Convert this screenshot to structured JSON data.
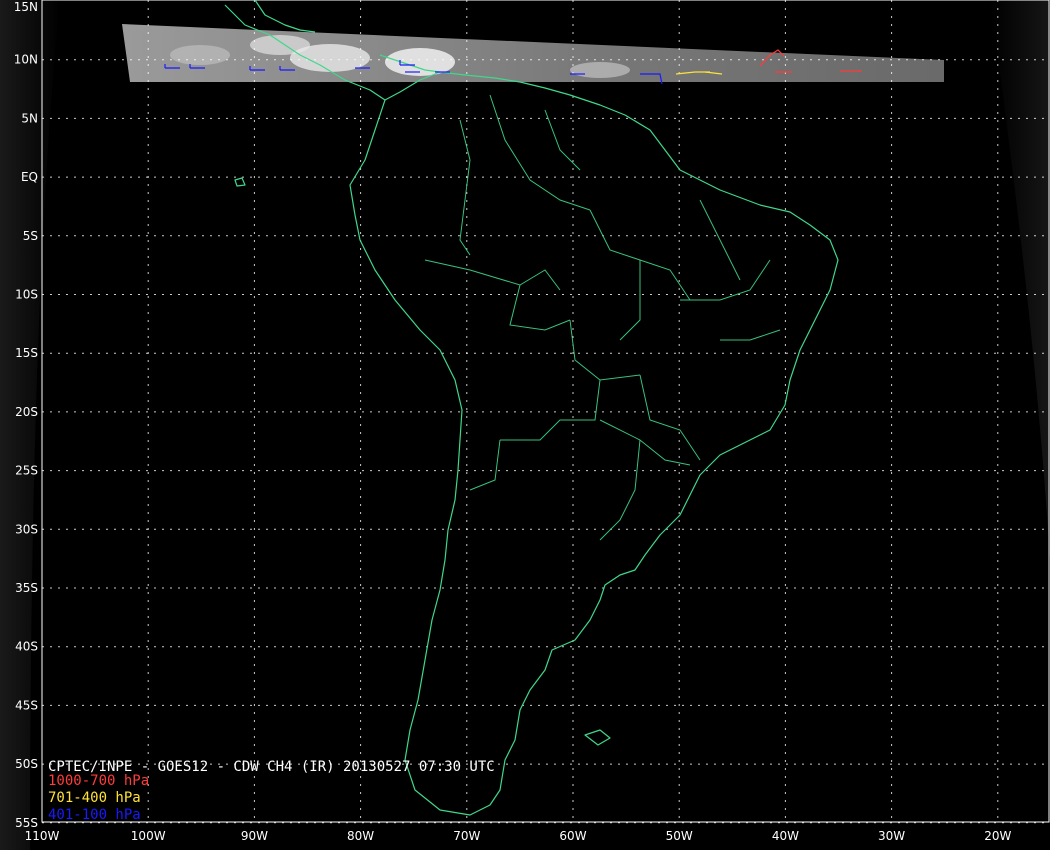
{
  "map": {
    "title_line": "CPTEC/INPE - GOES12 - CDW CH4 (IR) 20130527 07:30 UTC",
    "legend": [
      {
        "label": "1000-700 hPa",
        "color": "#ff3b3b"
      },
      {
        "label": "701-400 hPa",
        "color": "#ffe23a"
      },
      {
        "label": "401-100 hPa",
        "color": "#1a1aff"
      }
    ],
    "lat_labels": [
      "15N",
      "10N",
      "5N",
      "EQ",
      "5S",
      "10S",
      "15S",
      "20S",
      "25S",
      "30S",
      "35S",
      "40S",
      "45S",
      "50S",
      "55S"
    ],
    "lon_labels": [
      "110W",
      "100W",
      "90W",
      "80W",
      "70W",
      "60W",
      "50W",
      "40W",
      "30W",
      "20W"
    ],
    "colors": {
      "background": "#000000",
      "coastline": "#3fd88a",
      "grid": "#ffffff",
      "text": "#ffffff"
    }
  }
}
